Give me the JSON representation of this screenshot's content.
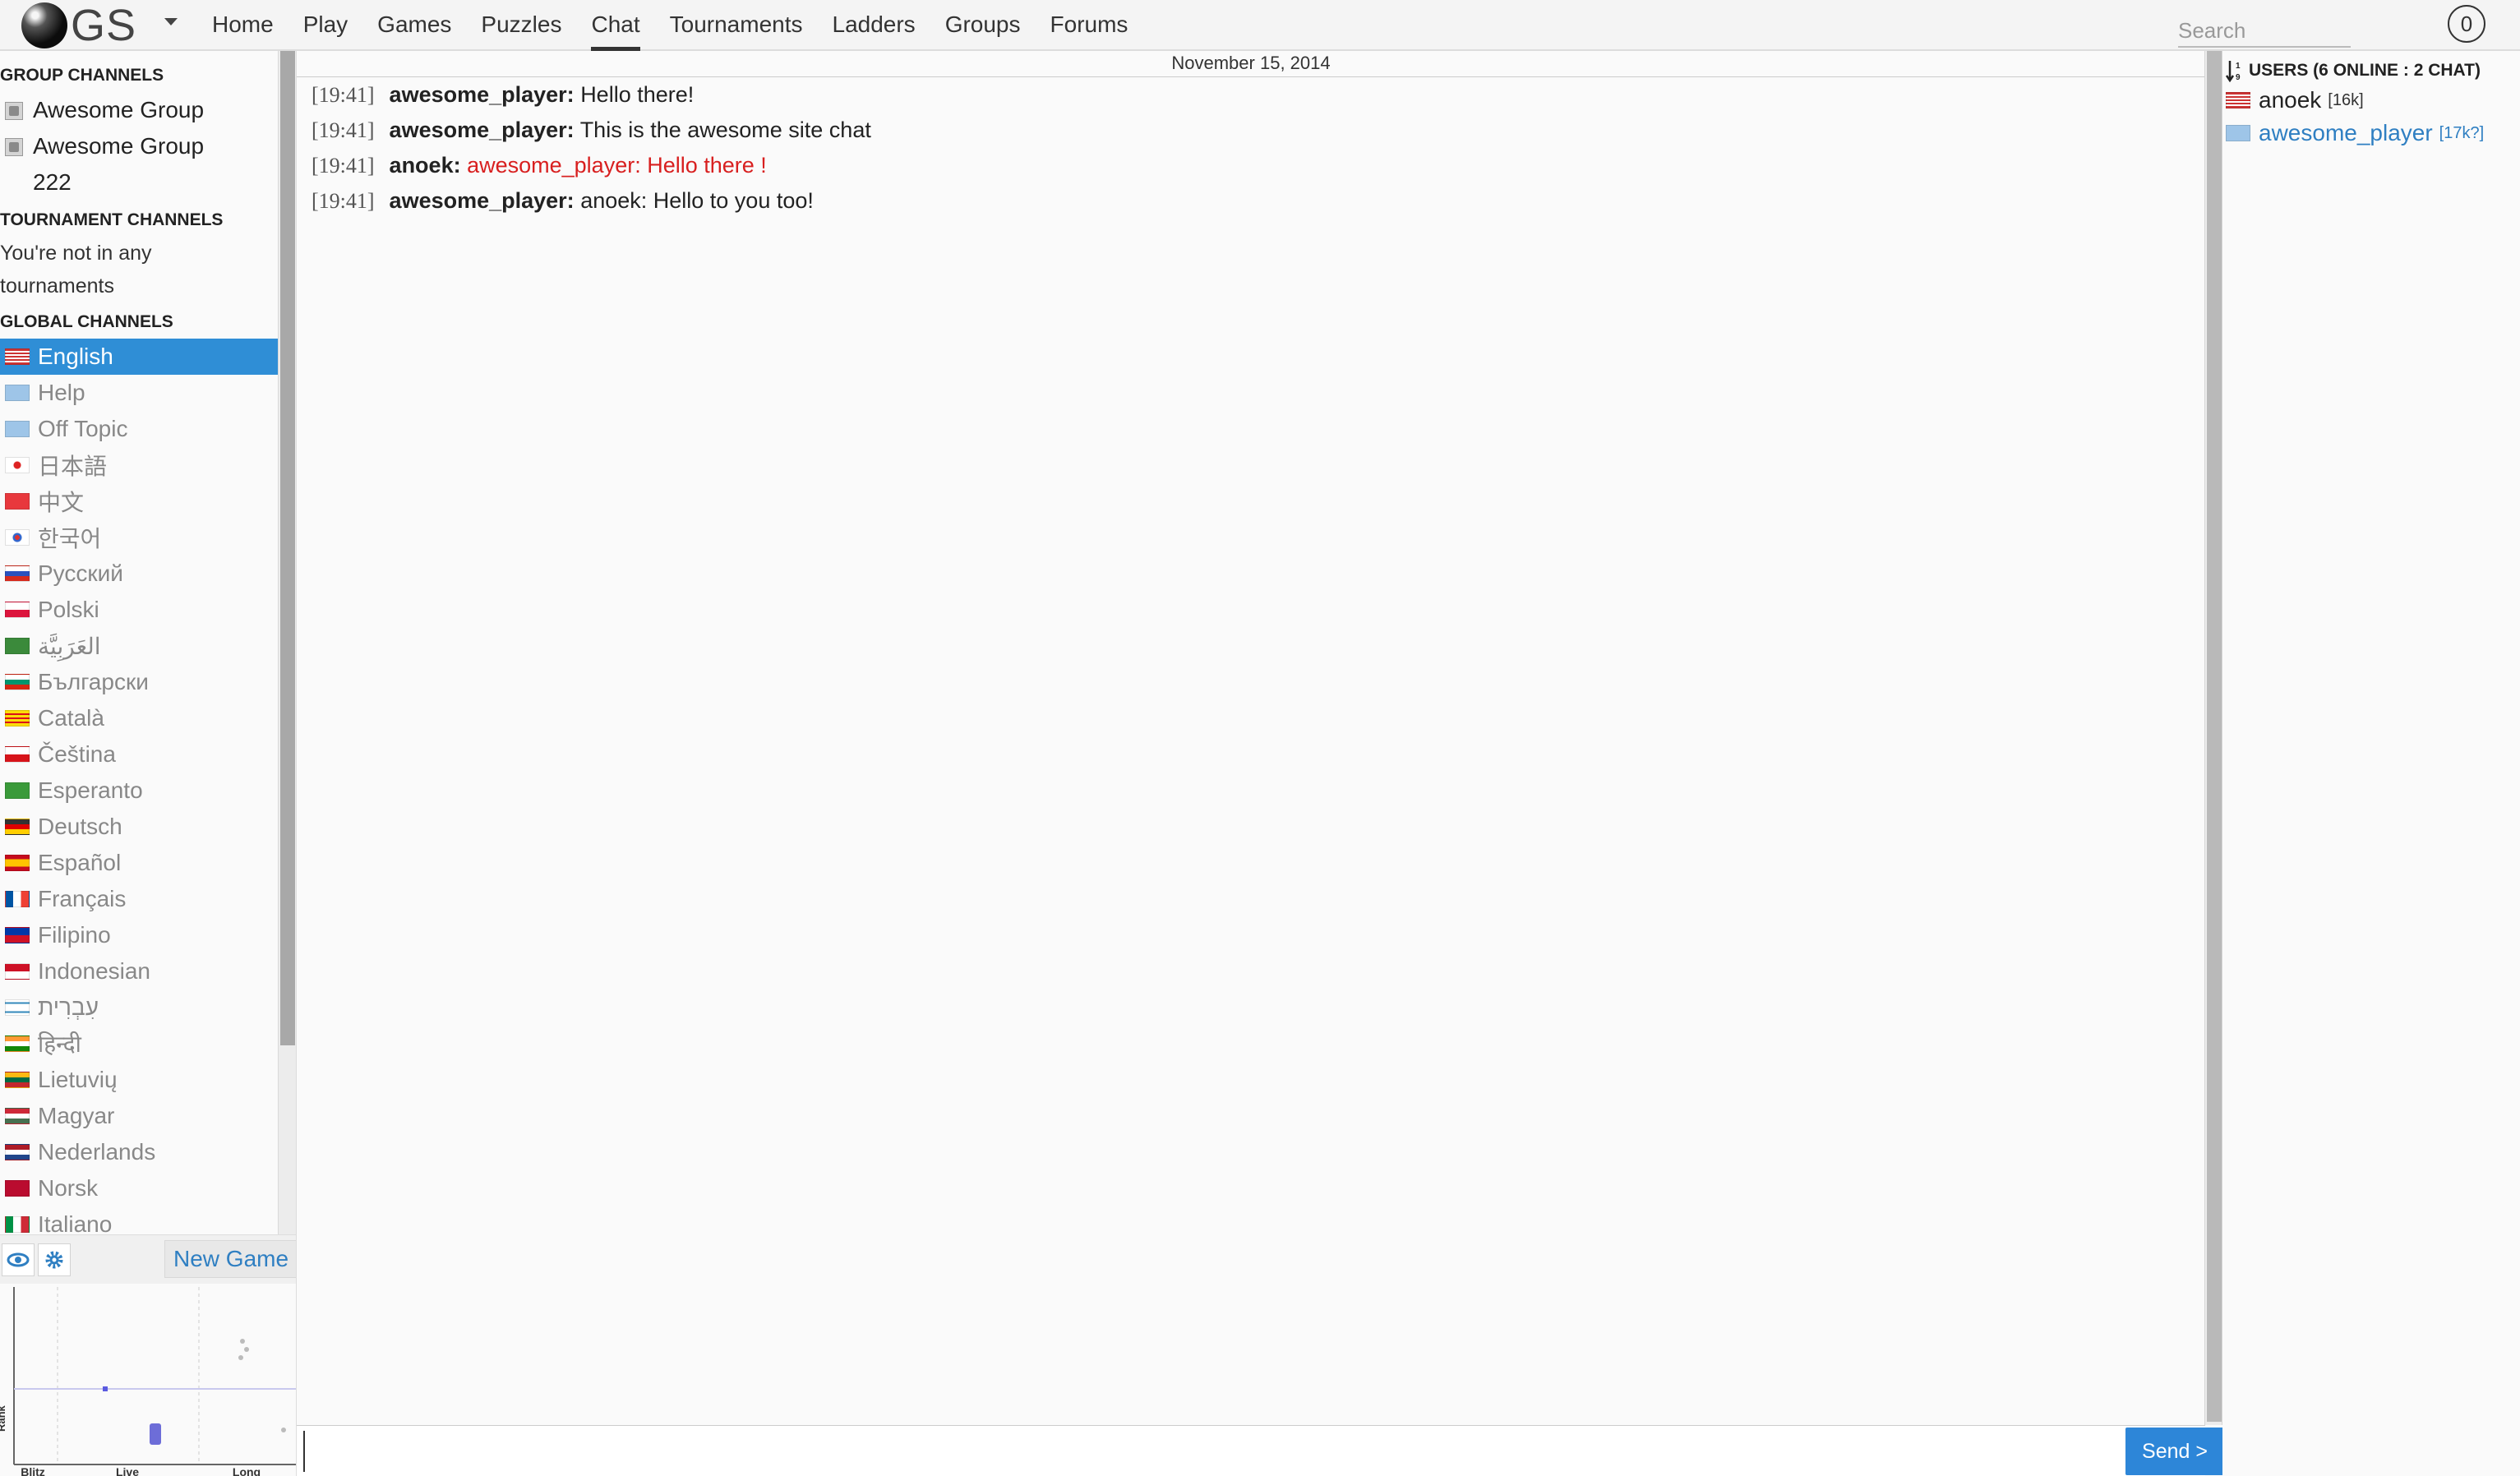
{
  "app": {
    "logo_text": "GS"
  },
  "nav": {
    "links": [
      "Home",
      "Play",
      "Games",
      "Puzzles",
      "Chat",
      "Tournaments",
      "Ladders",
      "Groups",
      "Forums"
    ],
    "active": "Chat",
    "search_placeholder": "Search",
    "notifications_count": "0"
  },
  "sidebar": {
    "group_heading": "GROUP CHANNELS",
    "groups": [
      "Awesome Group",
      "Awesome Group 222"
    ],
    "tournament_heading": "TOURNAMENT CHANNELS",
    "tournament_note": "You're not in any tournaments",
    "global_heading": "GLOBAL CHANNELS",
    "channels": [
      {
        "label": "English",
        "flag": "us",
        "active": true
      },
      {
        "label": "Help",
        "flag": "un",
        "active": false
      },
      {
        "label": "Off Topic",
        "flag": "un",
        "active": false
      },
      {
        "label": "日本語",
        "flag": "jp",
        "active": false
      },
      {
        "label": "中文",
        "flag": "cn",
        "active": false
      },
      {
        "label": "한국어",
        "flag": "kr",
        "active": false
      },
      {
        "label": "Русский",
        "flag": "ru",
        "active": false
      },
      {
        "label": "Polski",
        "flag": "pl",
        "active": false
      },
      {
        "label": "العَرَبِيَّة",
        "flag": "sa",
        "active": false
      },
      {
        "label": "Български",
        "flag": "bg",
        "active": false
      },
      {
        "label": "Català",
        "flag": "ct",
        "active": false
      },
      {
        "label": "Čeština",
        "flag": "cz",
        "active": false
      },
      {
        "label": "Esperanto",
        "flag": "eo",
        "active": false
      },
      {
        "label": "Deutsch",
        "flag": "de",
        "active": false
      },
      {
        "label": "Español",
        "flag": "es",
        "active": false
      },
      {
        "label": "Français",
        "flag": "fr",
        "active": false
      },
      {
        "label": "Filipino",
        "flag": "ph",
        "active": false
      },
      {
        "label": "Indonesian",
        "flag": "id",
        "active": false
      },
      {
        "label": "עִבְרִית",
        "flag": "il",
        "active": false
      },
      {
        "label": "हिन्दी",
        "flag": "in",
        "active": false
      },
      {
        "label": "Lietuvių",
        "flag": "lt",
        "active": false
      },
      {
        "label": "Magyar",
        "flag": "hu",
        "active": false
      },
      {
        "label": "Nederlands",
        "flag": "nl",
        "active": false
      },
      {
        "label": "Norsk",
        "flag": "no",
        "active": false
      },
      {
        "label": "Italiano",
        "flag": "it",
        "active": false
      }
    ],
    "new_game_label": "New Game",
    "toolbar_icons": [
      "eye-icon",
      "gear-icon"
    ]
  },
  "chart_data": {
    "type": "scatter",
    "title": "",
    "xlabel": "",
    "ylabel": "Rank",
    "categories": [
      "Blitz",
      "Live",
      "Long"
    ],
    "grid": true
  },
  "chat": {
    "date": "November 15, 2014",
    "messages": [
      {
        "time": "[19:41]",
        "user": "awesome_player:",
        "text": "Hello there!",
        "highlight": false
      },
      {
        "time": "[19:41]",
        "user": "awesome_player:",
        "text": "This is the awesome site chat",
        "highlight": false
      },
      {
        "time": "[19:41]",
        "user": "anoek:",
        "text": "awesome_player: Hello there !",
        "highlight": true
      },
      {
        "time": "[19:41]",
        "user": "awesome_player:",
        "text": "anoek: Hello to you too!",
        "highlight": false
      }
    ],
    "send_label": "Send >"
  },
  "users": {
    "heading": "USERS (6 ONLINE : 2 CHAT)",
    "sort_icon": "sort-numeric-icon",
    "list": [
      {
        "name": "anoek",
        "rank": "[16k]",
        "flag": "us",
        "link": false
      },
      {
        "name": "awesome_player",
        "rank": "[17k?]",
        "flag": "un",
        "link": true
      }
    ]
  },
  "colors": {
    "accent": "#2f8ed6",
    "highlight_text": "#d81f1f",
    "link": "#2f7fc2"
  }
}
